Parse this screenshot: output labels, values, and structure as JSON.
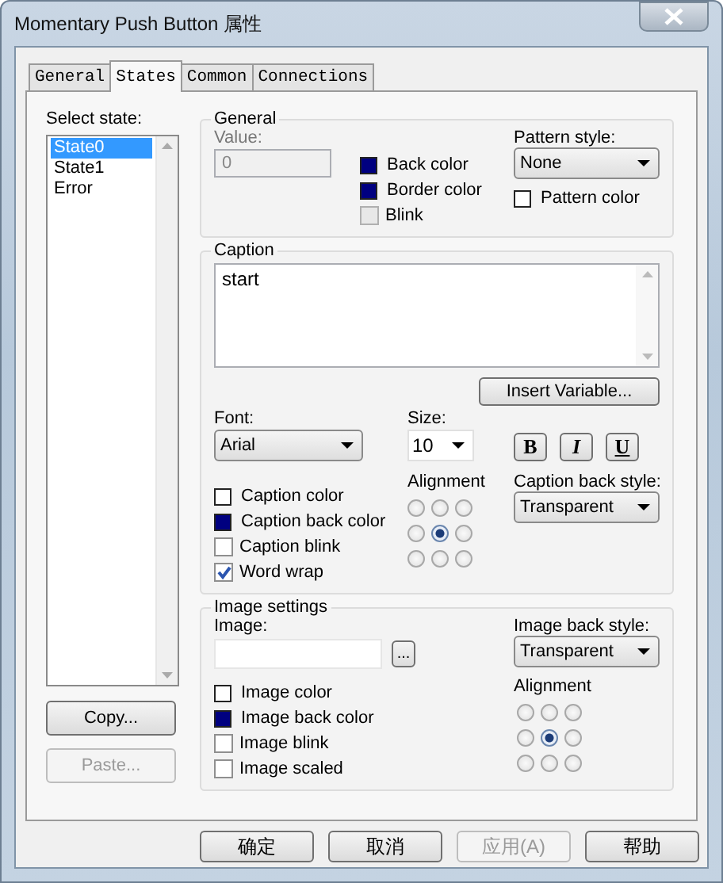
{
  "window": {
    "title": "Momentary Push Button 属性"
  },
  "tabs": [
    {
      "label": "General",
      "selected": false
    },
    {
      "label": "States",
      "selected": true
    },
    {
      "label": "Common",
      "selected": false
    },
    {
      "label": "Connections",
      "selected": false
    }
  ],
  "states": {
    "label": "Select state:",
    "items": [
      {
        "label": "State0",
        "selected": true
      },
      {
        "label": "State1",
        "selected": false
      },
      {
        "label": "Error",
        "selected": false
      }
    ],
    "buttons": [
      {
        "label": "Copy...",
        "disabled": false
      },
      {
        "label": "Paste...",
        "disabled": true
      }
    ]
  },
  "general": {
    "title": "General",
    "value_label": "Value:",
    "value": "0",
    "options": [
      {
        "kind": "swatch",
        "label": "Back color",
        "color": "#000080"
      },
      {
        "kind": "swatch",
        "label": "Border color",
        "color": "#000080"
      },
      {
        "kind": "checkbox",
        "label": "Blink",
        "checked": false,
        "disabled": true
      }
    ],
    "pattern_style_label": "Pattern style:",
    "pattern_style": "None",
    "pattern_color": {
      "kind": "swatch",
      "label": "Pattern color",
      "color": "#ffffff"
    }
  },
  "caption": {
    "title": "Caption",
    "text": "start",
    "insert_button": "Insert Variable...",
    "font_label": "Font:",
    "font": "Arial",
    "size_label": "Size:",
    "size": "10",
    "style_buttons": [
      {
        "label": "B",
        "kind": "bold"
      },
      {
        "label": "I",
        "kind": "italic"
      },
      {
        "label": "U",
        "kind": "underline"
      }
    ],
    "options": [
      {
        "kind": "swatch",
        "label": "Caption color",
        "color": "#ffffff"
      },
      {
        "kind": "swatch",
        "label": "Caption back color",
        "color": "#000080"
      },
      {
        "kind": "checkbox",
        "label": "Caption blink",
        "checked": false,
        "disabled": false
      },
      {
        "kind": "checkbox",
        "label": "Word wrap",
        "checked": true,
        "disabled": false
      }
    ],
    "alignment_label": "Alignment",
    "alignment": [
      {
        "selected": false
      },
      {
        "selected": false
      },
      {
        "selected": false
      },
      {
        "selected": false
      },
      {
        "selected": true
      },
      {
        "selected": false
      },
      {
        "selected": false
      },
      {
        "selected": false
      },
      {
        "selected": false
      }
    ],
    "back_style_label": "Caption back style:",
    "back_style": "Transparent"
  },
  "image": {
    "title": "Image settings",
    "image_label": "Image:",
    "browse_button": "...",
    "options": [
      {
        "kind": "swatch",
        "label": "Image color",
        "color": "#ffffff"
      },
      {
        "kind": "swatch",
        "label": "Image back color",
        "color": "#000080"
      },
      {
        "kind": "checkbox",
        "label": "Image blink",
        "checked": false,
        "disabled": false
      },
      {
        "kind": "checkbox",
        "label": "Image scaled",
        "checked": false,
        "disabled": false
      }
    ],
    "back_style_label": "Image back style:",
    "back_style": "Transparent",
    "alignment_label": "Alignment",
    "alignment": [
      {
        "selected": false
      },
      {
        "selected": false
      },
      {
        "selected": false
      },
      {
        "selected": false
      },
      {
        "selected": true
      },
      {
        "selected": false
      },
      {
        "selected": false
      },
      {
        "selected": false
      },
      {
        "selected": false
      }
    ]
  },
  "buttons": [
    {
      "label": "确定",
      "disabled": false
    },
    {
      "label": "取消",
      "disabled": false
    },
    {
      "label": "应用(A)",
      "disabled": true
    },
    {
      "label": "帮助",
      "disabled": false
    }
  ]
}
